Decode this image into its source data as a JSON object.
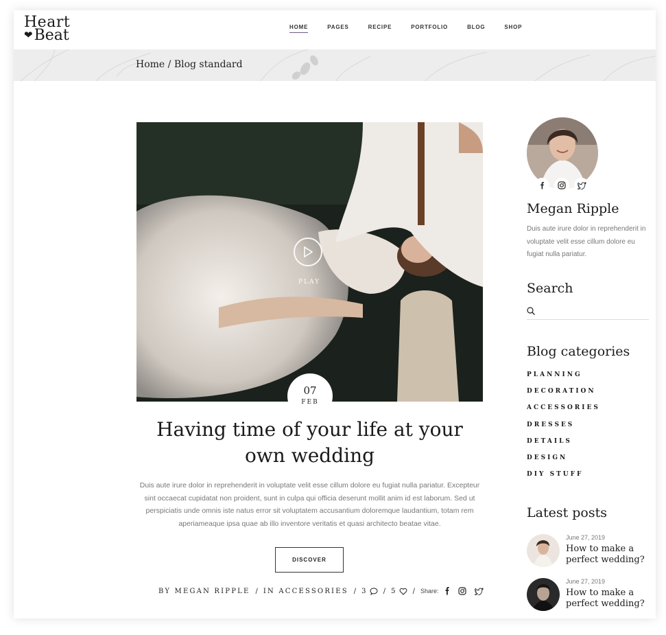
{
  "brand": {
    "line1": "Heart",
    "line2": "Beat"
  },
  "nav": [
    {
      "label": "HOME",
      "active": true
    },
    {
      "label": "PAGES"
    },
    {
      "label": "RECIPE"
    },
    {
      "label": "PORTFOLIO"
    },
    {
      "label": "BLOG"
    },
    {
      "label": "SHOP"
    }
  ],
  "breadcrumb": "Home / Blog standard",
  "post": {
    "play_label": "PLAY",
    "day": "07",
    "month": "FEB",
    "title": "Having time of your life at your own wedding",
    "excerpt": "Duis aute irure dolor in reprehenderit in voluptate velit esse cillum dolore eu fugiat nulla pariatur. Excepteur sint occaecat cupidatat non proident, sunt in culpa qui officia deserunt mollit anim id est laborum. Sed ut perspiciatis unde omnis iste natus error sit voluptatem accusantium doloremque laudantium, totam rem aperiameaque ipsa quae ab illo inventore veritatis et quasi architecto beatae vitae.",
    "button": "DISCOVER",
    "author": "BY MEGAN RIPPLE",
    "category": "IN ACCESSORIES",
    "comments": "3",
    "likes": "5",
    "share": "Share:"
  },
  "sidebar": {
    "author_name": "Megan Ripple",
    "author_bio": "Duis aute irure dolor in reprehenderit in voluptate velit esse cillum dolore eu fugiat nulla pariatur.",
    "search_title": "Search",
    "categories_title": "Blog categories",
    "categories": [
      "PLANNING",
      "DECORATION",
      "ACCESSORIES",
      "DRESSES",
      "DETAILS",
      "DESIGN",
      "DIY STUFF"
    ],
    "latest_title": "Latest posts",
    "latest": [
      {
        "date": "June 27, 2019",
        "title": "How to make a perfect wedding?"
      },
      {
        "date": "June 27, 2019",
        "title": "How to make a perfect wedding?"
      }
    ]
  },
  "colors": {
    "accent": "#6f5a8a",
    "band": "#ededed",
    "text": "#1a1a1a",
    "muted": "#777777"
  }
}
